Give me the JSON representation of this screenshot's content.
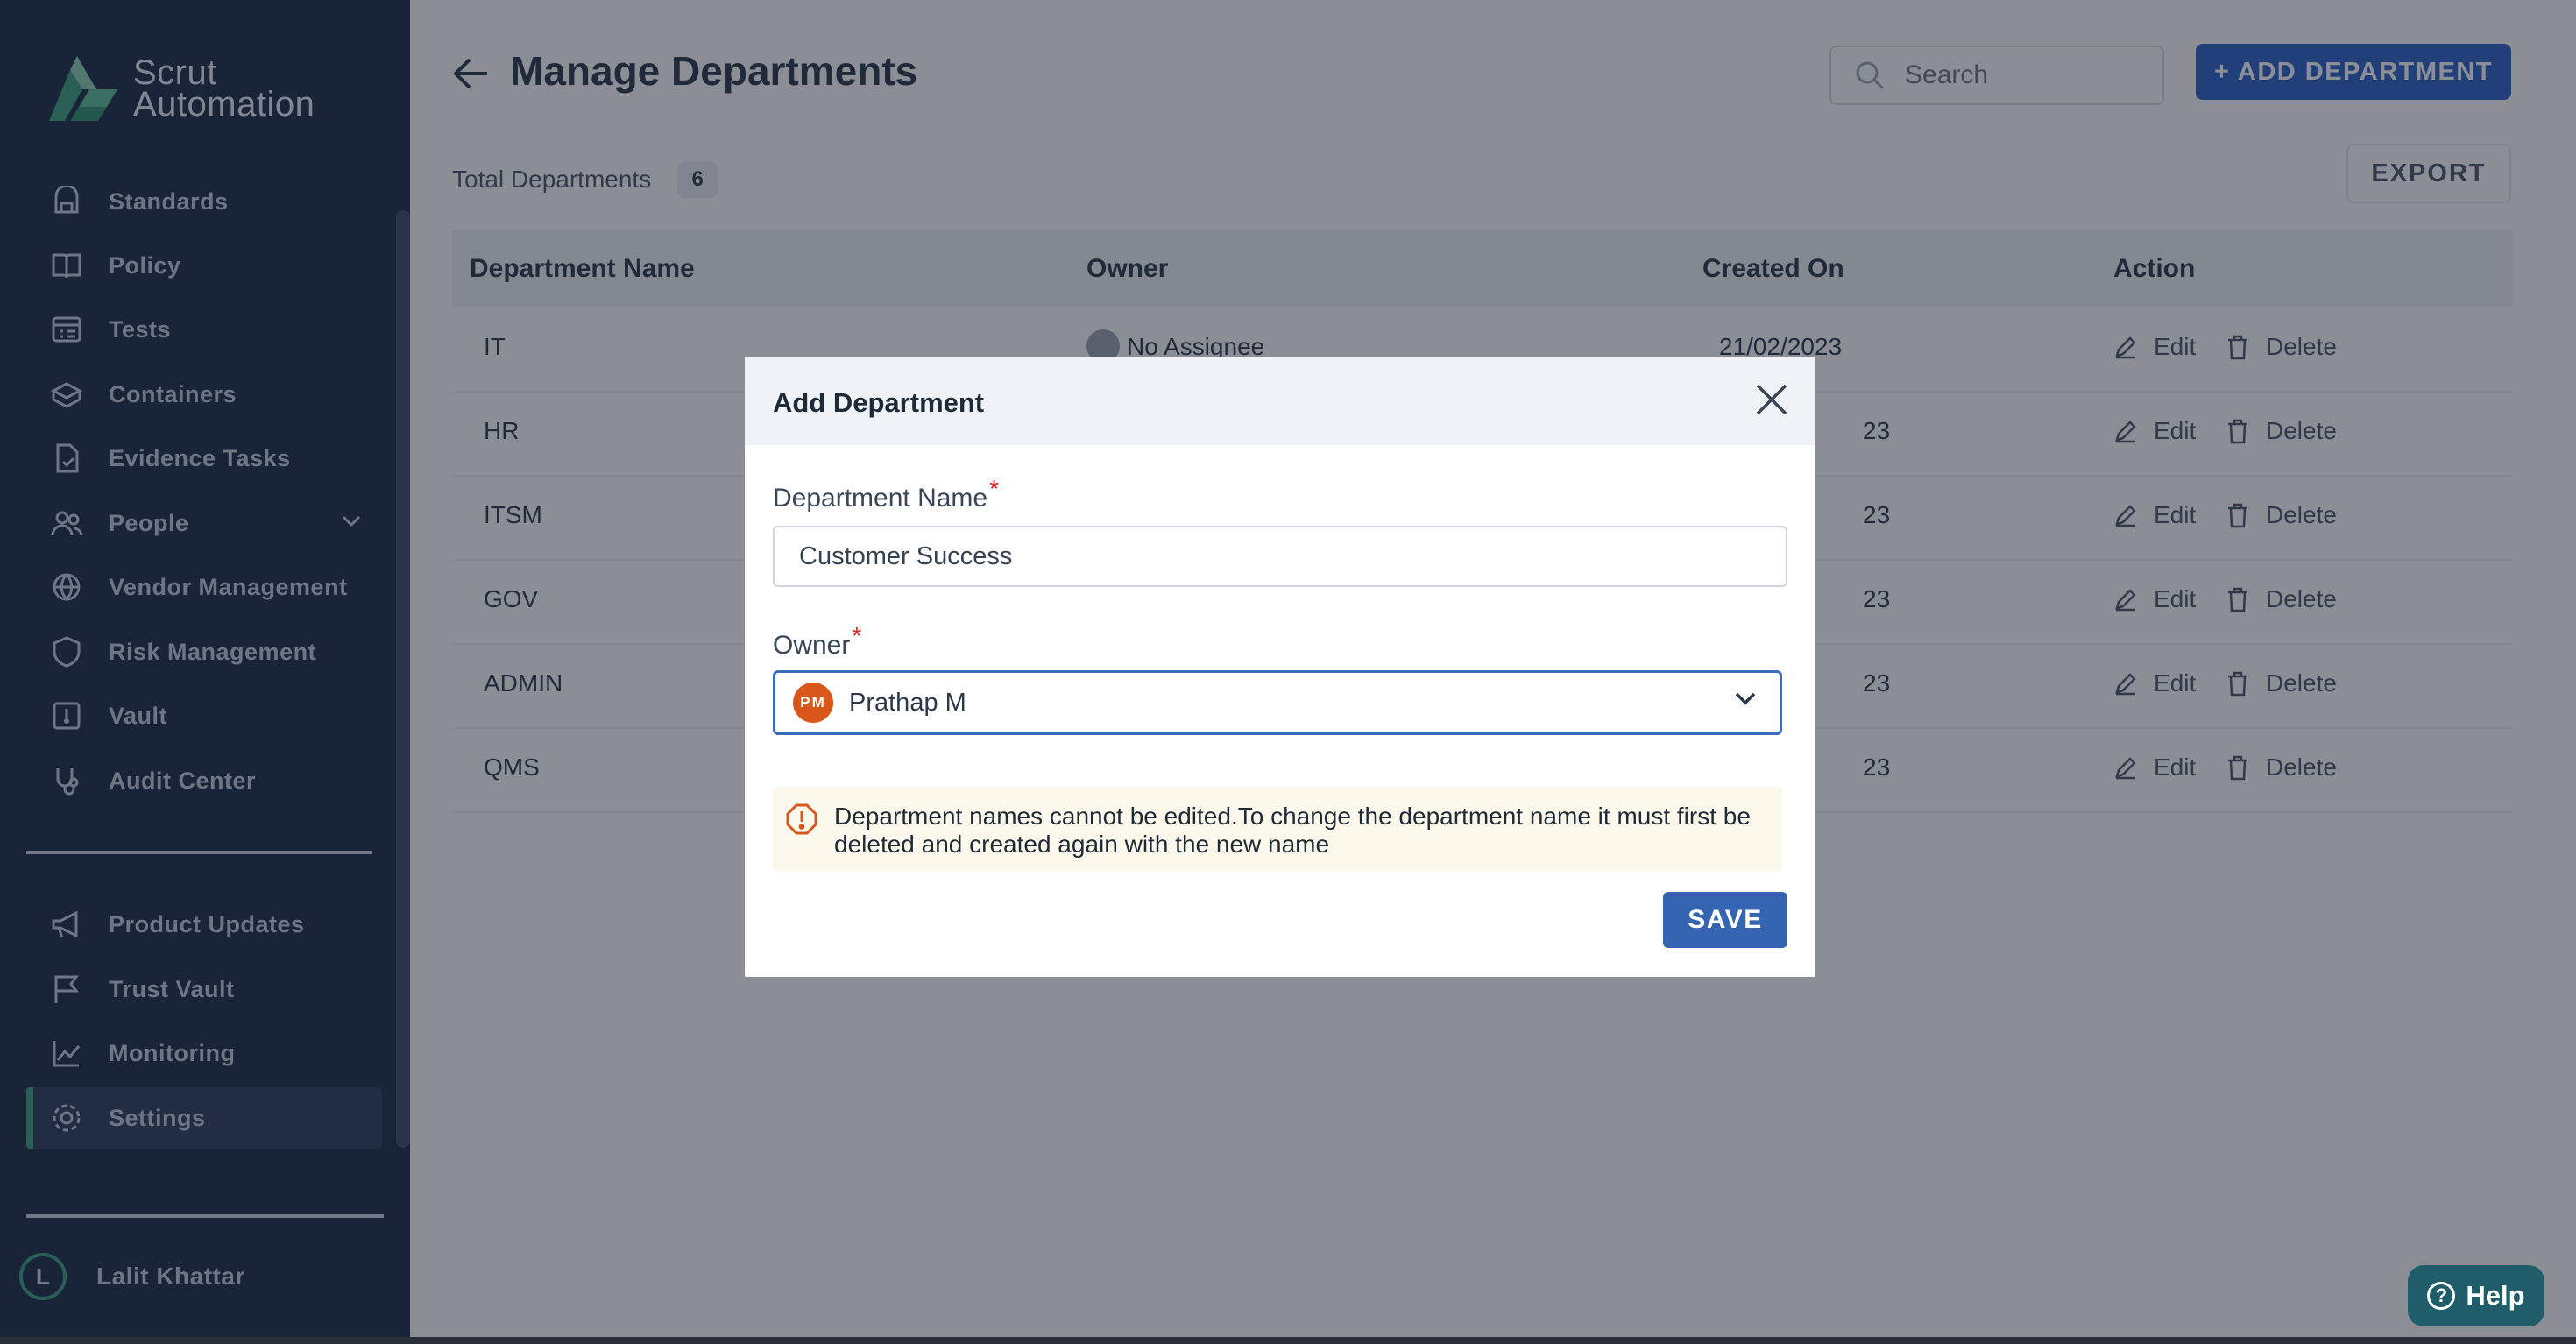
{
  "sidebar": {
    "brand_line1": "Scrut",
    "brand_line2": "Automation",
    "items": [
      {
        "label": "Standards",
        "icon": "standards-icon"
      },
      {
        "label": "Policy",
        "icon": "policy-icon"
      },
      {
        "label": "Tests",
        "icon": "tests-icon"
      },
      {
        "label": "Containers",
        "icon": "containers-icon"
      },
      {
        "label": "Evidence Tasks",
        "icon": "evidence-icon"
      },
      {
        "label": "People",
        "icon": "people-icon"
      },
      {
        "label": "Vendor Management",
        "icon": "vendor-icon"
      },
      {
        "label": "Risk Management",
        "icon": "risk-icon"
      },
      {
        "label": "Vault",
        "icon": "vault-icon"
      },
      {
        "label": "Audit Center",
        "icon": "audit-icon"
      }
    ],
    "bottom_items": [
      {
        "label": "Product Updates",
        "icon": "megaphone-icon"
      },
      {
        "label": "Trust Vault",
        "icon": "flag-icon"
      },
      {
        "label": "Monitoring",
        "icon": "chart-icon"
      },
      {
        "label": "Settings",
        "icon": "gear-icon"
      }
    ],
    "active_item": "Settings",
    "user": {
      "initial": "L",
      "name": "Lalit Khattar"
    }
  },
  "header": {
    "title": "Manage Departments",
    "search_placeholder": "Search",
    "add_button": "+ ADD DEPARTMENT",
    "export_button": "EXPORT",
    "total_label": "Total Departments",
    "total_count": "6"
  },
  "table": {
    "columns": [
      "Department Name",
      "Owner",
      "Created On",
      "Action"
    ],
    "rows": [
      {
        "name": "IT",
        "owner": "No Assignee",
        "created": "21/02/2023"
      },
      {
        "name": "HR",
        "owner": "",
        "created": "23"
      },
      {
        "name": "ITSM",
        "owner": "",
        "created": "23"
      },
      {
        "name": "GOV",
        "owner": "",
        "created": "23"
      },
      {
        "name": "ADMIN",
        "owner": "",
        "created": "23"
      },
      {
        "name": "QMS",
        "owner": "",
        "created": "23"
      }
    ],
    "edit_label": "Edit",
    "delete_label": "Delete"
  },
  "modal": {
    "title": "Add Department",
    "name_label": "Department Name",
    "name_value": "Customer Success",
    "owner_label": "Owner",
    "required_mark": "*",
    "owner_initials": "PM",
    "owner_name": "Prathap M",
    "notice": "Department names cannot be edited.To change the department name it must first be deleted and created again with the new name",
    "save_button": "SAVE"
  },
  "help_button": "Help",
  "colors": {
    "sidebar_bg": "#1b2a47",
    "accent_green": "#3aa17e",
    "primary_blue": "#2b63c9",
    "save_blue": "#3464b2",
    "owner_avatar": "#d9571a",
    "notice_bg": "#fdf8ec",
    "warning_orange": "#d9571a"
  }
}
